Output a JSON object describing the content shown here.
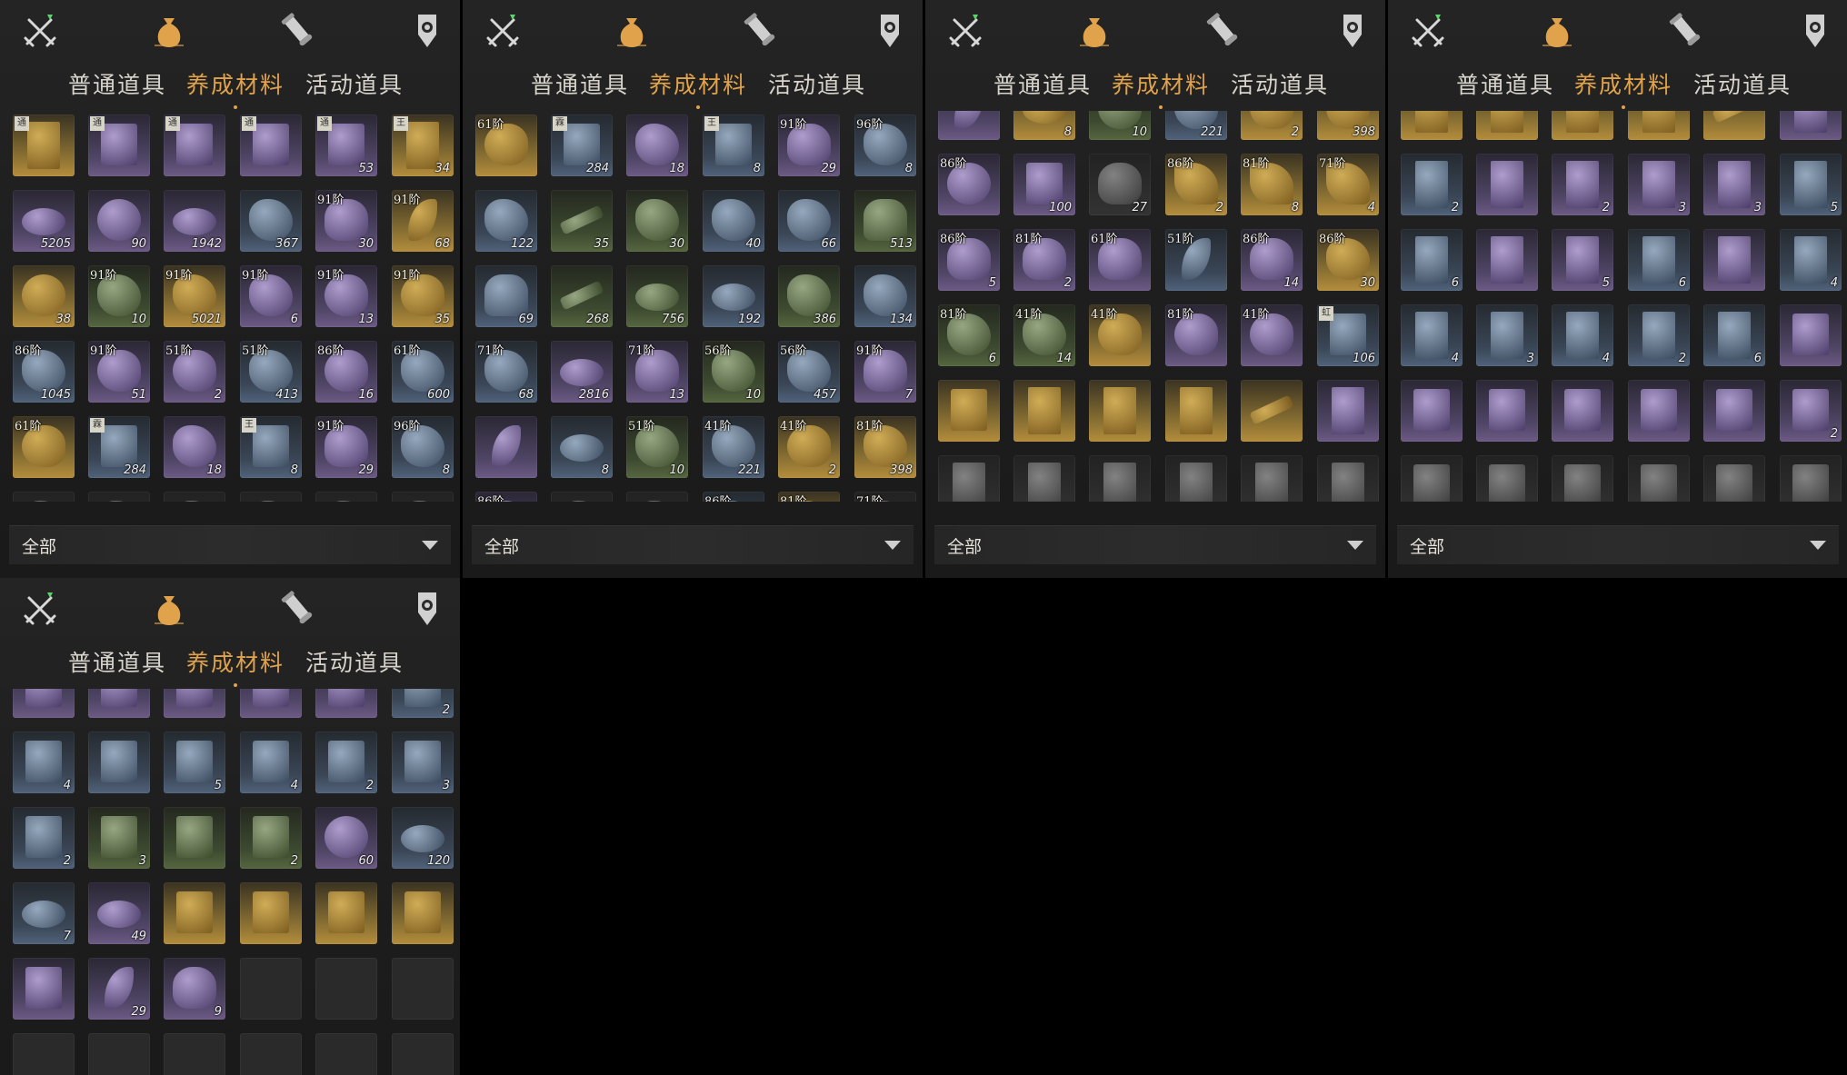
{
  "colors": {
    "accent": "#e0a24a",
    "tab_text": "#d8d4cc",
    "background": "#1f1f1f"
  },
  "icons": [
    "crossed-swords-icon",
    "pouch-icon",
    "scroll-icon",
    "medal-icon"
  ],
  "tabs": [
    "普通道具",
    "养成材料",
    "活动道具"
  ],
  "active_tab_index": 1,
  "filter": {
    "label": "全部"
  },
  "panels": [
    {
      "first_row_partial": false,
      "rows": [
        [
          {
            "r": "gold",
            "t": "scroll",
            "b": "通"
          },
          {
            "r": "purple",
            "t": "book",
            "b": "通"
          },
          {
            "r": "purple",
            "t": "book",
            "b": "通"
          },
          {
            "r": "purple",
            "t": "book",
            "b": "通"
          },
          {
            "r": "purple",
            "t": "book",
            "b": "通",
            "c": "53"
          },
          {
            "r": "gold",
            "t": "scroll",
            "b": "王",
            "c": "34"
          }
        ],
        [
          {
            "r": "purple",
            "t": "plate",
            "c": "5205"
          },
          {
            "r": "purple",
            "t": "orb",
            "c": "90"
          },
          {
            "r": "purple",
            "t": "plate",
            "c": "1942"
          },
          {
            "r": "blue",
            "t": "rock",
            "c": "367"
          },
          {
            "r": "purple",
            "t": "flower",
            "l": "91阶",
            "c": "30"
          },
          {
            "r": "gold",
            "t": "leaf",
            "l": "91阶",
            "c": "68"
          }
        ],
        [
          {
            "r": "gold",
            "t": "orb",
            "c": "38"
          },
          {
            "r": "green",
            "t": "rock",
            "l": "91阶",
            "c": "10"
          },
          {
            "r": "gold",
            "t": "rock",
            "l": "91阶",
            "c": "5021"
          },
          {
            "r": "purple",
            "t": "rock",
            "l": "91阶",
            "c": "6"
          },
          {
            "r": "purple",
            "t": "shell",
            "l": "91阶",
            "c": "13"
          },
          {
            "r": "gold",
            "t": "shell",
            "l": "91阶",
            "c": "35"
          }
        ],
        [
          {
            "r": "blue",
            "t": "rock",
            "l": "86阶",
            "c": "1045"
          },
          {
            "r": "purple",
            "t": "shell",
            "l": "91阶",
            "c": "51"
          },
          {
            "r": "purple",
            "t": "shell",
            "l": "51阶",
            "c": "2"
          },
          {
            "r": "blue",
            "t": "rock",
            "l": "51阶",
            "c": "413"
          },
          {
            "r": "purple",
            "t": "shell",
            "l": "86阶",
            "c": "16"
          },
          {
            "r": "blue",
            "t": "rock",
            "l": "61阶",
            "c": "600"
          }
        ],
        [
          {
            "r": "gold",
            "t": "shell",
            "l": "61阶"
          },
          {
            "r": "blue",
            "t": "book",
            "b": "霖",
            "c": "284"
          },
          {
            "r": "purple",
            "t": "rock",
            "c": "18"
          },
          {
            "r": "blue",
            "t": "book",
            "b": "王",
            "c": "8"
          },
          {
            "r": "purple",
            "t": "flower",
            "l": "91阶",
            "c": "29"
          },
          {
            "r": "blue",
            "t": "rock",
            "l": "96阶",
            "c": "8"
          }
        ],
        [
          {
            "r": "gray",
            "t": "rock"
          },
          {
            "r": "gray",
            "t": "rock"
          },
          {
            "r": "gray",
            "t": "rock"
          },
          {
            "r": "gray",
            "t": "rock"
          },
          {
            "r": "gray",
            "t": "rock"
          },
          {
            "r": "gray",
            "t": "rock"
          }
        ]
      ]
    },
    {
      "first_row_partial": false,
      "rows": [
        [
          {
            "r": "gold",
            "t": "shell",
            "l": "61阶"
          },
          {
            "r": "blue",
            "t": "book",
            "b": "霖",
            "c": "284"
          },
          {
            "r": "purple",
            "t": "rock",
            "c": "18"
          },
          {
            "r": "blue",
            "t": "book",
            "b": "王",
            "c": "8"
          },
          {
            "r": "purple",
            "t": "flower",
            "l": "91阶",
            "c": "29"
          },
          {
            "r": "blue",
            "t": "rock",
            "l": "96阶",
            "c": "8"
          }
        ],
        [
          {
            "r": "blue",
            "t": "rock",
            "c": "122"
          },
          {
            "r": "green",
            "t": "stick",
            "c": "35"
          },
          {
            "r": "green",
            "t": "rock",
            "c": "30"
          },
          {
            "r": "blue",
            "t": "rock",
            "c": "40"
          },
          {
            "r": "blue",
            "t": "rock",
            "c": "66"
          },
          {
            "r": "green",
            "t": "pot",
            "c": "513"
          }
        ],
        [
          {
            "r": "blue",
            "t": "pot",
            "c": "69"
          },
          {
            "r": "green",
            "t": "stick",
            "c": "268"
          },
          {
            "r": "green",
            "t": "plate",
            "c": "756"
          },
          {
            "r": "blue",
            "t": "plate",
            "c": "192"
          },
          {
            "r": "green",
            "t": "rock",
            "c": "386"
          },
          {
            "r": "blue",
            "t": "rock",
            "c": "134"
          }
        ],
        [
          {
            "r": "blue",
            "t": "rock",
            "l": "71阶",
            "c": "68"
          },
          {
            "r": "purple",
            "t": "plate",
            "c": "2816"
          },
          {
            "r": "purple",
            "t": "flower",
            "l": "71阶",
            "c": "13"
          },
          {
            "r": "green",
            "t": "rock",
            "l": "56阶",
            "c": "10"
          },
          {
            "r": "blue",
            "t": "rock",
            "l": "56阶",
            "c": "457"
          },
          {
            "r": "purple",
            "t": "flower",
            "l": "91阶",
            "c": "7"
          }
        ],
        [
          {
            "r": "purple",
            "t": "leaf"
          },
          {
            "r": "blue",
            "t": "plate",
            "c": "8"
          },
          {
            "r": "green",
            "t": "rock",
            "l": "51阶",
            "c": "10"
          },
          {
            "r": "blue",
            "t": "rock",
            "l": "41阶",
            "c": "221"
          },
          {
            "r": "gold",
            "t": "shell",
            "l": "41阶",
            "c": "2"
          },
          {
            "r": "gold",
            "t": "rock",
            "l": "81阶",
            "c": "398"
          }
        ],
        [
          {
            "r": "purple",
            "t": "orb",
            "l": "86阶"
          },
          {
            "r": "gray",
            "t": "rock"
          },
          {
            "r": "gray",
            "t": "rock"
          },
          {
            "r": "blue",
            "t": "rock",
            "l": "86阶"
          },
          {
            "r": "gold",
            "t": "rock",
            "l": "81阶"
          },
          {
            "r": "gray",
            "t": "rock",
            "l": "71阶"
          }
        ]
      ]
    },
    {
      "first_row_partial": true,
      "rows": [
        [
          {
            "r": "purple",
            "t": "leaf"
          },
          {
            "r": "gold",
            "t": "plate",
            "c": "8"
          },
          {
            "r": "green",
            "t": "rock",
            "c": "10"
          },
          {
            "r": "blue",
            "t": "rock",
            "c": "221"
          },
          {
            "r": "gold",
            "t": "shell",
            "c": "2"
          },
          {
            "r": "gold",
            "t": "rock",
            "c": "398"
          }
        ],
        [
          {
            "r": "purple",
            "t": "orb",
            "l": "86阶"
          },
          {
            "r": "purple",
            "t": "book",
            "c": "100"
          },
          {
            "r": "gray",
            "t": "flower",
            "c": "27"
          },
          {
            "r": "gold",
            "t": "shard",
            "l": "86阶",
            "c": "2"
          },
          {
            "r": "gold",
            "t": "shard",
            "l": "81阶",
            "c": "8"
          },
          {
            "r": "gold",
            "t": "shard",
            "l": "71阶",
            "c": "4"
          }
        ],
        [
          {
            "r": "purple",
            "t": "flower",
            "l": "86阶",
            "c": "5"
          },
          {
            "r": "purple",
            "t": "flower",
            "l": "81阶",
            "c": "2"
          },
          {
            "r": "purple",
            "t": "flower",
            "l": "61阶"
          },
          {
            "r": "blue",
            "t": "leaf",
            "l": "51阶"
          },
          {
            "r": "purple",
            "t": "flower",
            "l": "86阶",
            "c": "14"
          },
          {
            "r": "gold",
            "t": "rock",
            "l": "86阶",
            "c": "30"
          }
        ],
        [
          {
            "r": "green",
            "t": "rock",
            "l": "81阶",
            "c": "6"
          },
          {
            "r": "green",
            "t": "rock",
            "l": "41阶",
            "c": "14"
          },
          {
            "r": "gold",
            "t": "shell",
            "l": "41阶"
          },
          {
            "r": "purple",
            "t": "shell",
            "l": "81阶"
          },
          {
            "r": "purple",
            "t": "shell",
            "l": "41阶"
          },
          {
            "r": "blue",
            "t": "book",
            "b": "虹",
            "c": "106"
          }
        ],
        [
          {
            "r": "gold",
            "t": "book"
          },
          {
            "r": "gold",
            "t": "scroll"
          },
          {
            "r": "gold",
            "t": "scroll"
          },
          {
            "r": "gold",
            "t": "scroll"
          },
          {
            "r": "gold",
            "t": "stick"
          },
          {
            "r": "purple",
            "t": "scroll"
          }
        ],
        [
          {
            "r": "gray",
            "t": "scroll"
          },
          {
            "r": "gray",
            "t": "scroll"
          },
          {
            "r": "gray",
            "t": "scroll"
          },
          {
            "r": "gray",
            "t": "scroll"
          },
          {
            "r": "gray",
            "t": "scroll"
          },
          {
            "r": "gray",
            "t": "scroll"
          }
        ]
      ]
    },
    {
      "first_row_partial": true,
      "rows": [
        [
          {
            "r": "gold",
            "t": "scroll"
          },
          {
            "r": "gold",
            "t": "scroll"
          },
          {
            "r": "gold",
            "t": "scroll"
          },
          {
            "r": "gold",
            "t": "scroll"
          },
          {
            "r": "gold",
            "t": "stick"
          },
          {
            "r": "purple",
            "t": "scroll"
          }
        ],
        [
          {
            "r": "blue",
            "t": "scroll",
            "c": "2"
          },
          {
            "r": "purple",
            "t": "scroll"
          },
          {
            "r": "purple",
            "t": "scroll",
            "c": "2"
          },
          {
            "r": "purple",
            "t": "scroll",
            "c": "3"
          },
          {
            "r": "purple",
            "t": "scroll",
            "c": "3"
          },
          {
            "r": "blue",
            "t": "scroll",
            "c": "5"
          }
        ],
        [
          {
            "r": "blue",
            "t": "scroll",
            "c": "6"
          },
          {
            "r": "purple",
            "t": "scroll"
          },
          {
            "r": "purple",
            "t": "scroll",
            "c": "5"
          },
          {
            "r": "blue",
            "t": "scroll",
            "c": "6"
          },
          {
            "r": "purple",
            "t": "scroll"
          },
          {
            "r": "blue",
            "t": "scroll",
            "c": "4"
          }
        ],
        [
          {
            "r": "blue",
            "t": "scroll",
            "c": "4"
          },
          {
            "r": "blue",
            "t": "scroll",
            "c": "3"
          },
          {
            "r": "blue",
            "t": "scroll",
            "c": "4"
          },
          {
            "r": "blue",
            "t": "scroll",
            "c": "2"
          },
          {
            "r": "blue",
            "t": "scroll",
            "c": "6"
          },
          {
            "r": "purple",
            "t": "book"
          }
        ],
        [
          {
            "r": "purple",
            "t": "book"
          },
          {
            "r": "purple",
            "t": "book"
          },
          {
            "r": "purple",
            "t": "book"
          },
          {
            "r": "purple",
            "t": "book"
          },
          {
            "r": "purple",
            "t": "book"
          },
          {
            "r": "purple",
            "t": "book",
            "c": "2"
          }
        ],
        [
          {
            "r": "gray",
            "t": "book"
          },
          {
            "r": "gray",
            "t": "book"
          },
          {
            "r": "gray",
            "t": "book"
          },
          {
            "r": "gray",
            "t": "book"
          },
          {
            "r": "gray",
            "t": "book"
          },
          {
            "r": "gray",
            "t": "book"
          }
        ]
      ]
    },
    {
      "first_row_partial": true,
      "rows": [
        [
          {
            "r": "purple",
            "t": "book"
          },
          {
            "r": "purple",
            "t": "book"
          },
          {
            "r": "purple",
            "t": "book"
          },
          {
            "r": "purple",
            "t": "book"
          },
          {
            "r": "purple",
            "t": "book"
          },
          {
            "r": "blue",
            "t": "book",
            "c": "2"
          }
        ],
        [
          {
            "r": "blue",
            "t": "book",
            "c": "4"
          },
          {
            "r": "blue",
            "t": "book"
          },
          {
            "r": "blue",
            "t": "book",
            "c": "5"
          },
          {
            "r": "blue",
            "t": "book",
            "c": "4"
          },
          {
            "r": "blue",
            "t": "book",
            "c": "2"
          },
          {
            "r": "blue",
            "t": "book",
            "c": "3"
          }
        ],
        [
          {
            "r": "blue",
            "t": "book",
            "c": "2"
          },
          {
            "r": "green",
            "t": "book",
            "c": "3"
          },
          {
            "r": "green",
            "t": "book"
          },
          {
            "r": "green",
            "t": "book",
            "c": "2"
          },
          {
            "r": "purple",
            "t": "orb",
            "c": "60"
          },
          {
            "r": "blue",
            "t": "plate",
            "c": "120"
          }
        ],
        [
          {
            "r": "blue",
            "t": "plate",
            "c": "7"
          },
          {
            "r": "purple",
            "t": "plate",
            "c": "49"
          },
          {
            "r": "gold",
            "t": "book"
          },
          {
            "r": "gold",
            "t": "book"
          },
          {
            "r": "gold",
            "t": "book"
          },
          {
            "r": "gold",
            "t": "book"
          }
        ],
        [
          {
            "r": "purple",
            "t": "book"
          },
          {
            "r": "purple",
            "t": "leaf",
            "c": "29"
          },
          {
            "r": "purple",
            "t": "flower",
            "c": "9"
          },
          {
            "r": "empty"
          },
          {
            "r": "empty"
          },
          {
            "r": "empty"
          }
        ],
        [
          {
            "r": "empty"
          },
          {
            "r": "empty"
          },
          {
            "r": "empty"
          },
          {
            "r": "empty"
          },
          {
            "r": "empty"
          },
          {
            "r": "empty"
          }
        ]
      ]
    }
  ]
}
